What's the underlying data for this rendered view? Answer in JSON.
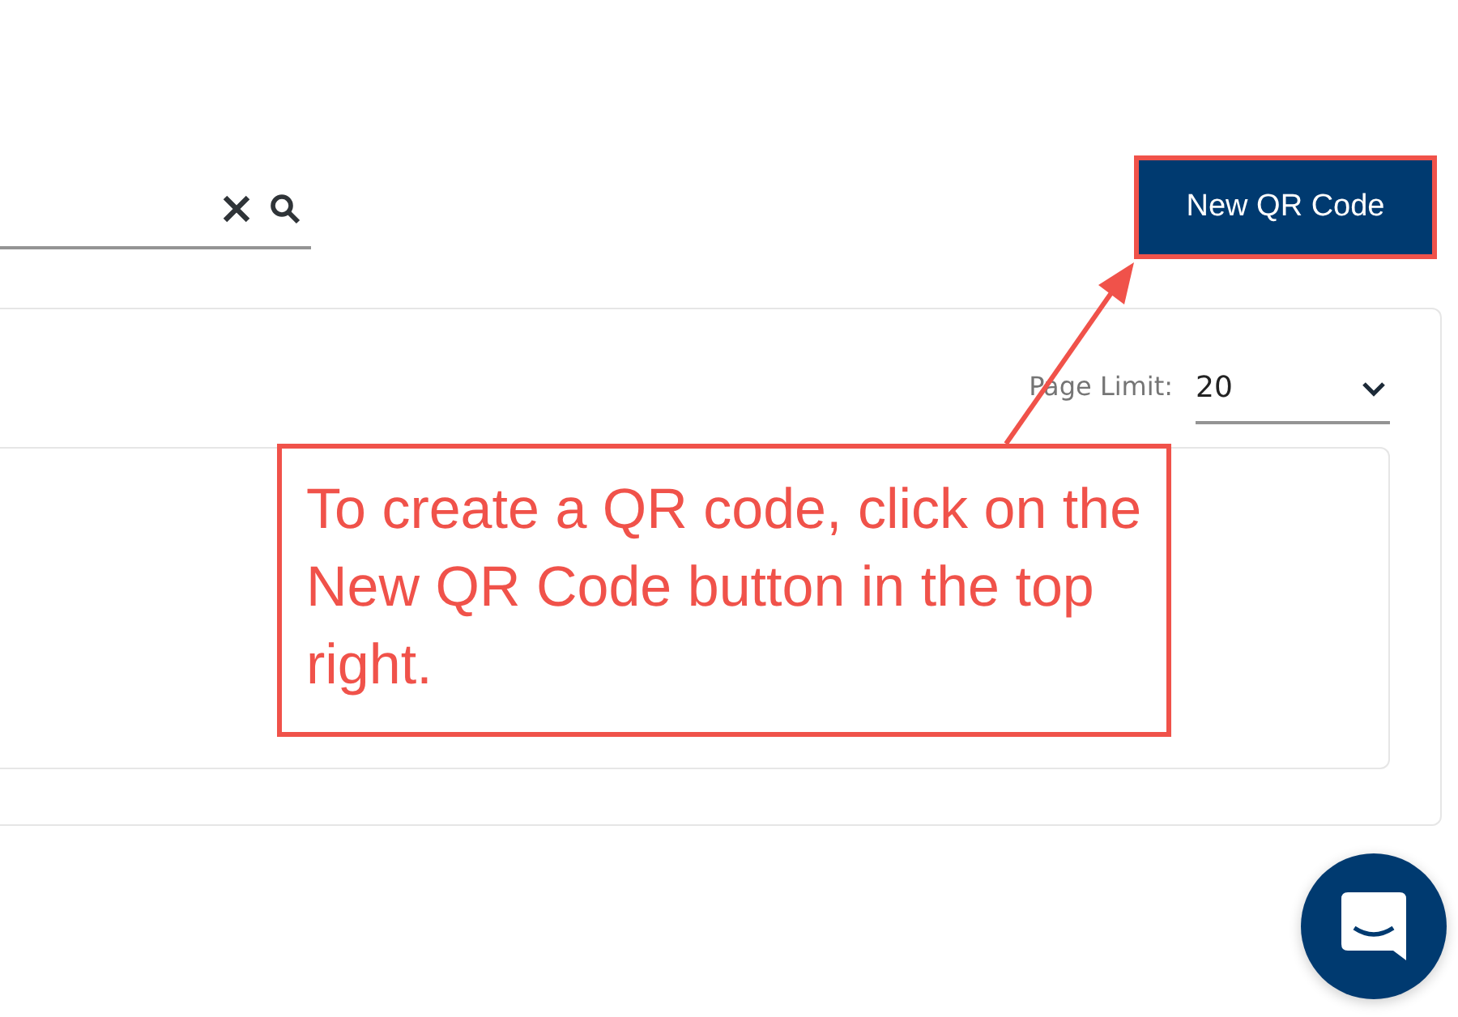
{
  "toolbar": {
    "new_button": "New QR Code"
  },
  "panel": {
    "page_limit": {
      "label": "Page Limit:",
      "value": "20"
    }
  },
  "annotation": {
    "text": "To create a QR code, click on the New QR Code button in the top right."
  }
}
